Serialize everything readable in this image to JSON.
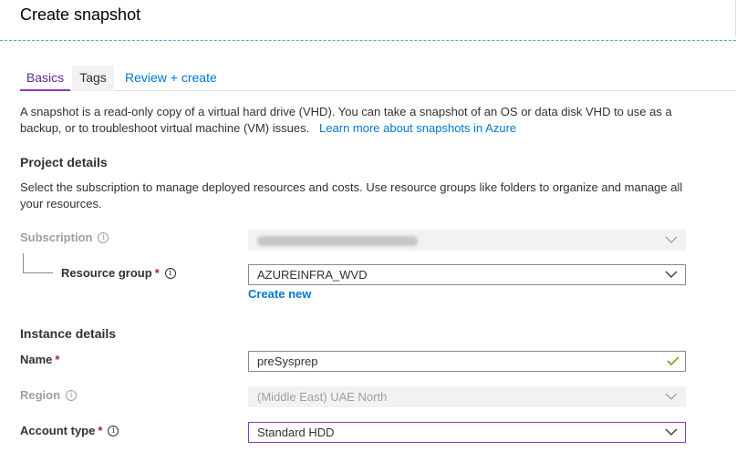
{
  "page": {
    "title": "Create snapshot"
  },
  "tabs": [
    {
      "label": "Basics",
      "active": true
    },
    {
      "label": "Tags",
      "active": false
    },
    {
      "label": "Review + create",
      "active": false
    }
  ],
  "intro": {
    "text": "A snapshot is a read-only copy of a virtual hard drive (VHD). You can take a snapshot of an OS or data disk VHD to use as a backup, or to troubleshoot virtual machine (VM) issues.",
    "link": "Learn more about snapshots in Azure"
  },
  "project": {
    "title": "Project details",
    "description": "Select the subscription to manage deployed resources and costs. Use resource groups like folders to organize and manage all your resources.",
    "subscription_label": "Subscription",
    "resource_group_label": "Resource group",
    "resource_group_value": "AZUREINFRA_WVD",
    "create_new": "Create new"
  },
  "instance": {
    "title": "Instance details",
    "name_label": "Name",
    "name_value": "preSysprep",
    "region_label": "Region",
    "region_value": "(Middle East) UAE North",
    "account_type_label": "Account type",
    "account_type_value": "Standard HDD"
  },
  "common": {
    "required_mark": "*",
    "info_glyph": "i"
  },
  "colors": {
    "accent_purple": "#8a3ab9",
    "link_blue": "#0078d4",
    "required_red": "#a4262c",
    "valid_green": "#57a300"
  }
}
